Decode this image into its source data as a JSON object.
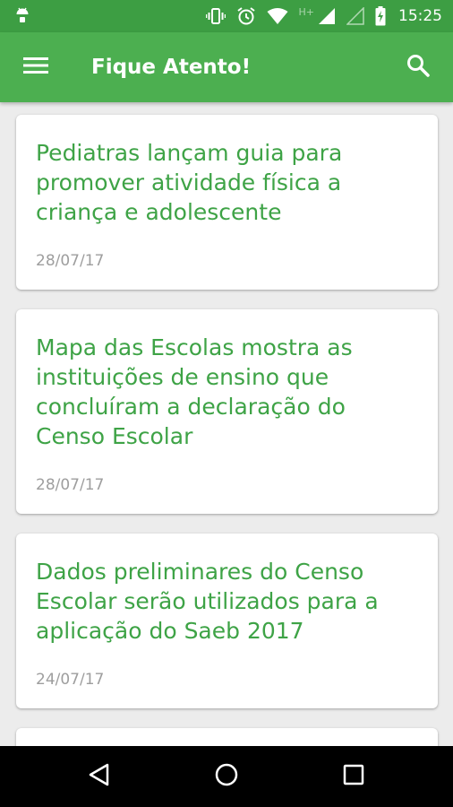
{
  "status_bar": {
    "time": "15:25",
    "network": "H+",
    "icons": [
      "android-icon",
      "vibrate-icon",
      "alarm-icon",
      "wifi-icon",
      "signal-icon",
      "signal-icon",
      "battery-charging-icon"
    ]
  },
  "app_bar": {
    "title": "Fique Atento!",
    "menu_icon": "hamburger-menu-icon",
    "search_icon": "search-icon"
  },
  "feed": {
    "items": [
      {
        "title": "Pediatras lançam guia para promover atividade física a criança e adolescente",
        "date": "28/07/17"
      },
      {
        "title": "Mapa das Escolas mostra as instituições de ensino que concluíram a declaração do Censo Escolar",
        "date": "28/07/17"
      },
      {
        "title": "Dados preliminares do Censo Escolar serão utilizados para a aplicação do Saeb 2017",
        "date": "24/07/17"
      }
    ]
  },
  "nav_bar": {
    "icons": [
      "back-icon",
      "home-icon",
      "recents-icon"
    ]
  },
  "colors": {
    "status_bar": "#3d9e43",
    "app_bar": "#4caf50",
    "title_green": "#3ea346",
    "date_gray": "#9e9e9e",
    "background": "#ececec"
  }
}
